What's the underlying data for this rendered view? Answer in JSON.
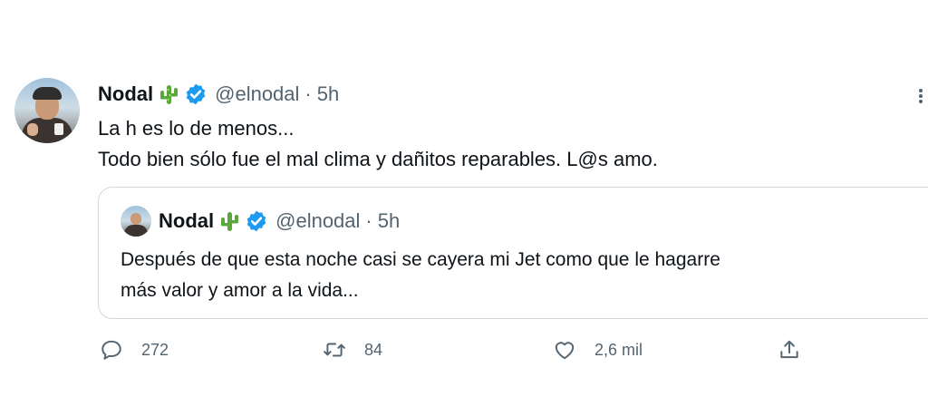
{
  "tweet": {
    "author_name": "Nodal",
    "author_emoji": "cactus",
    "handle": "@elnodal",
    "separator": "·",
    "time": "5h",
    "text_lines": [
      "La h es lo de menos...",
      "Todo bien sólo fue el mal clima y dañitos reparables. L@s amo."
    ]
  },
  "quoted_tweet": {
    "author_name": "Nodal",
    "handle": "@elnodal",
    "separator": "·",
    "time": "5h",
    "text_lines": [
      "Después de que esta noche casi se cayera mi Jet como que le hagarre",
      "más valor y amor a la vida..."
    ]
  },
  "actions": {
    "replies": "272",
    "retweets": "84",
    "likes": "2,6 mil"
  },
  "icons": {
    "verified": "verified-badge-icon",
    "reply": "reply-icon",
    "retweet": "retweet-icon",
    "like": "heart-icon",
    "share": "share-icon",
    "more": "more-options-icon"
  },
  "colors": {
    "text": "#0f1419",
    "secondary": "#536471",
    "verified": "#1d9bf0",
    "border": "#cfd9de",
    "cactus": "#5aa73a"
  }
}
